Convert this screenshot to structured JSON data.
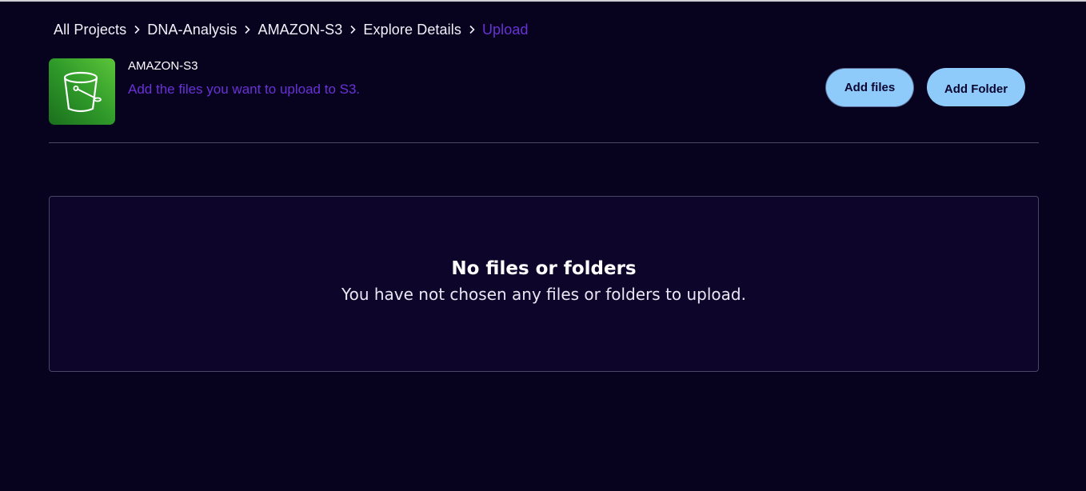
{
  "breadcrumb": {
    "items": [
      {
        "label": "All Projects"
      },
      {
        "label": "DNA-Analysis"
      },
      {
        "label": "AMAZON-S3"
      },
      {
        "label": "Explore Details"
      },
      {
        "label": "Upload"
      }
    ],
    "separator_icon": "chevron-right-icon"
  },
  "header": {
    "icon": "s3-bucket-icon",
    "title": "AMAZON-S3",
    "subtitle": "Add the files you want to upload to S3."
  },
  "actions": {
    "add_files_label": "Add files",
    "add_folder_label": "Add Folder"
  },
  "dropzone": {
    "empty_title": "No files or folders",
    "empty_message": "You have not chosen any files or folders to upload."
  },
  "colors": {
    "background": "#07031f",
    "accent": "#6a31d6",
    "button": "#8ecbfb",
    "icon_green": "#2f9a2a"
  }
}
